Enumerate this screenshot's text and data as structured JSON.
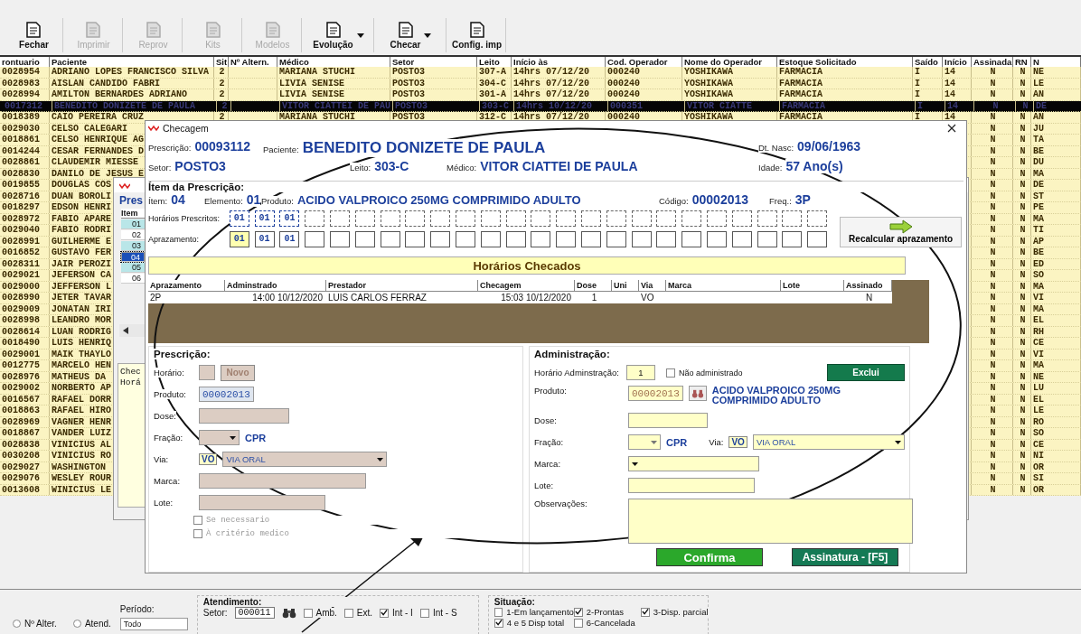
{
  "toolbar": [
    {
      "label": "Fechar",
      "disabled": false,
      "dropdown": false
    },
    {
      "label": "Imprimir",
      "disabled": true,
      "dropdown": false
    },
    {
      "label": "Reprov",
      "disabled": true,
      "dropdown": false
    },
    {
      "label": "Kits",
      "disabled": true,
      "dropdown": false
    },
    {
      "label": "Modelos",
      "disabled": true,
      "dropdown": false
    },
    {
      "label": "Evolução",
      "disabled": false,
      "dropdown": true
    },
    {
      "label": "Checar",
      "disabled": false,
      "dropdown": true
    },
    {
      "label": "Config. imp",
      "disabled": false,
      "dropdown": false
    }
  ],
  "table": {
    "columns": [
      "rontuario",
      "Paciente",
      "Sit",
      "Nº Altern.",
      "Médico",
      "Setor",
      "Leito",
      "Início às",
      "Cod. Operador",
      "Nome do Operador",
      "Estoque Solicitado",
      "Saído",
      "Início",
      "Assinada",
      "RN",
      "N"
    ],
    "rows": [
      {
        "prontuario": "0028954",
        "paciente": "ADRIANO LOPES FRANCISCO SILVA",
        "sit": "2",
        "medico": "MARIANA STUCHI",
        "setor": "POSTO3",
        "leito": "307-A",
        "inicio_as": "14hrs 07/12/20",
        "cod_operador": "000240",
        "nome_operador": "YOSHIKAWA",
        "estoque": "FARMACIA",
        "saido": "I",
        "inicio": "14",
        "assinada": "N",
        "rn": "N",
        "col_16": "NE",
        "selected": false
      },
      {
        "prontuario": "0028983",
        "paciente": "AISLAN CANDIDO FABRI",
        "sit": "2",
        "medico": "LIVIA SENISE",
        "setor": "POSTO3",
        "leito": "304-C",
        "inicio_as": "14hrs 07/12/20",
        "cod_operador": "000240",
        "nome_operador": "YOSHIKAWA",
        "estoque": "FARMACIA",
        "saido": "I",
        "inicio": "14",
        "assinada": "N",
        "rn": "N",
        "col_16": "LE",
        "selected": false
      },
      {
        "prontuario": "0028994",
        "paciente": "AMILTON BERNARDES ADRIANO",
        "sit": "2",
        "medico": "LIVIA SENISE",
        "setor": "POSTO3",
        "leito": "301-A",
        "inicio_as": "14hrs 07/12/20",
        "cod_operador": "000240",
        "nome_operador": "YOSHIKAWA",
        "estoque": "FARMACIA",
        "saido": "I",
        "inicio": "14",
        "assinada": "N",
        "rn": "N",
        "col_16": "AN",
        "selected": false
      },
      {
        "prontuario": "0017312",
        "paciente": "BENEDITO DONIZETE DE PAULA",
        "sit": "2",
        "medico": "VITOR CIATTEI DE PAU",
        "setor": "POSTO3",
        "leito": "303-C",
        "inicio_as": "14hrs 10/12/20",
        "cod_operador": "000351",
        "nome_operador": "VITOR CIATTE",
        "estoque": "FARMACIA",
        "saido": "I",
        "inicio": "14",
        "assinada": "N",
        "rn": "N",
        "col_16": "DE",
        "selected": true
      },
      {
        "prontuario": "0018389",
        "paciente": "CAIO PEREIRA CRUZ",
        "sit": "2",
        "medico": "MARIANA STUCHI",
        "setor": "POSTO3",
        "leito": "312-C",
        "inicio_as": "14hrs 07/12/20",
        "cod_operador": "000240",
        "nome_operador": "YOSHIKAWA",
        "estoque": "FARMACIA",
        "saido": "I",
        "inicio": "14",
        "assinada": "N",
        "rn": "N",
        "col_16": "AN",
        "selected": false
      },
      {
        "prontuario": "0029030",
        "paciente": "CELSO CALEGARI",
        "assinada": "N",
        "rn": "N",
        "col_16": "JU",
        "selected": false
      },
      {
        "prontuario": "0018861",
        "paciente": "CELSO HENRIQUE AG",
        "assinada": "N",
        "rn": "N",
        "col_16": "TA",
        "selected": false
      },
      {
        "prontuario": "0014244",
        "paciente": "CESAR FERNANDES D",
        "assinada": "N",
        "rn": "N",
        "col_16": "BE",
        "selected": false
      },
      {
        "prontuario": "0028861",
        "paciente": "CLAUDEMIR MIESSE",
        "assinada": "N",
        "rn": "N",
        "col_16": "DU",
        "selected": false
      },
      {
        "prontuario": "0028830",
        "paciente": "DANILO DE JESUS E",
        "assinada": "N",
        "rn": "N",
        "col_16": "MA",
        "selected": false
      },
      {
        "prontuario": "0019855",
        "paciente": "DOUGLAS COS",
        "assinada": "N",
        "rn": "N",
        "col_16": "DE",
        "selected": false
      },
      {
        "prontuario": "0028716",
        "paciente": "DUAN BOROLI",
        "assinada": "N",
        "rn": "N",
        "col_16": "ST",
        "selected": false
      },
      {
        "prontuario": "0018297",
        "paciente": "EDSON HENRI",
        "assinada": "N",
        "rn": "N",
        "col_16": "PE",
        "selected": false
      },
      {
        "prontuario": "0028972",
        "paciente": "FABIO APARE",
        "assinada": "N",
        "rn": "N",
        "col_16": "MA",
        "selected": false
      },
      {
        "prontuario": "0029040",
        "paciente": "FABIO RODRI",
        "assinada": "N",
        "rn": "N",
        "col_16": "TI",
        "selected": false
      },
      {
        "prontuario": "0028991",
        "paciente": "GUILHERME E",
        "assinada": "N",
        "rn": "N",
        "col_16": "AP",
        "selected": false
      },
      {
        "prontuario": "0016852",
        "paciente": "GUSTAVO FER",
        "assinada": "N",
        "rn": "N",
        "col_16": "BE",
        "selected": false
      },
      {
        "prontuario": "0028311",
        "paciente": "JAIR PEROZI",
        "assinada": "N",
        "rn": "N",
        "col_16": "ED",
        "selected": false
      },
      {
        "prontuario": "0029021",
        "paciente": "JEFERSON CA",
        "assinada": "N",
        "rn": "N",
        "col_16": "SO",
        "selected": false
      },
      {
        "prontuario": "0029000",
        "paciente": "JEFFERSON L",
        "assinada": "N",
        "rn": "N",
        "col_16": "MA",
        "selected": false
      },
      {
        "prontuario": "0028990",
        "paciente": "JETER TAVAR",
        "assinada": "N",
        "rn": "N",
        "col_16": "VI",
        "selected": false
      },
      {
        "prontuario": "0029009",
        "paciente": "JONATAN IRI",
        "assinada": "N",
        "rn": "N",
        "col_16": "MA",
        "selected": false
      },
      {
        "prontuario": "0028998",
        "paciente": "LEANDRO MOR",
        "assinada": "N",
        "rn": "N",
        "col_16": "EL",
        "selected": false
      },
      {
        "prontuario": "0028614",
        "paciente": "LUAN RODRIG",
        "assinada": "N",
        "rn": "N",
        "col_16": "RH",
        "selected": false
      },
      {
        "prontuario": "0018490",
        "paciente": "LUIS HENRIQ",
        "assinada": "N",
        "rn": "N",
        "col_16": "CE",
        "selected": false
      },
      {
        "prontuario": "0029001",
        "paciente": "MAIK THAYLO",
        "assinada": "N",
        "rn": "N",
        "col_16": "VI",
        "selected": false
      },
      {
        "prontuario": "0012775",
        "paciente": "MARCELO HEN",
        "assinada": "N",
        "rn": "N",
        "col_16": "MA",
        "selected": false
      },
      {
        "prontuario": "0028976",
        "paciente": "MATHEUS DA",
        "assinada": "N",
        "rn": "N",
        "col_16": "NE",
        "selected": false
      },
      {
        "prontuario": "0029002",
        "paciente": "NORBERTO AP",
        "assinada": "N",
        "rn": "N",
        "col_16": "LU",
        "selected": false
      },
      {
        "prontuario": "0016567",
        "paciente": "RAFAEL DORR",
        "assinada": "N",
        "rn": "N",
        "col_16": "EL",
        "selected": false
      },
      {
        "prontuario": "0018863",
        "paciente": "RAFAEL HIRO",
        "assinada": "N",
        "rn": "N",
        "col_16": "LE",
        "selected": false
      },
      {
        "prontuario": "0028969",
        "paciente": "VAGNER HENR",
        "assinada": "N",
        "rn": "N",
        "col_16": "RO",
        "selected": false
      },
      {
        "prontuario": "0018867",
        "paciente": "VANDER LUIZ",
        "assinada": "N",
        "rn": "N",
        "col_16": "SO",
        "selected": false
      },
      {
        "prontuario": "0028838",
        "paciente": "VINICIUS AL",
        "assinada": "N",
        "rn": "N",
        "col_16": "CE",
        "selected": false
      },
      {
        "prontuario": "0030208",
        "paciente": "VINICIUS RO",
        "assinada": "N",
        "rn": "N",
        "col_16": "NI",
        "selected": false
      },
      {
        "prontuario": "0029027",
        "paciente": "WASHINGTON",
        "assinada": "N",
        "rn": "N",
        "col_16": "OR",
        "selected": false
      },
      {
        "prontuario": "0029076",
        "paciente": "WESLEY ROUR",
        "assinada": "N",
        "rn": "N",
        "col_16": "SI",
        "selected": false
      },
      {
        "prontuario": "0013608",
        "paciente": "WINICIUS LE",
        "assinada": "N",
        "rn": "N",
        "col_16": "OR",
        "selected": false
      }
    ]
  },
  "prescricao_window": {
    "title_fragment": "Pres",
    "item_header": "Item",
    "items": [
      {
        "label": "01",
        "selected": false,
        "color": "#b9e6e8"
      },
      {
        "label": "02",
        "selected": false,
        "color": "#ffffff"
      },
      {
        "label": "03",
        "selected": false,
        "color": "#b9e6e8"
      },
      {
        "label": "04",
        "selected": true,
        "color": "#1b4fb8"
      },
      {
        "label": "05",
        "selected": false,
        "color": "#b9e6e8"
      },
      {
        "label": "06",
        "selected": false,
        "color": "#ffffff"
      }
    ],
    "notes": [
      "Chec",
      "Horá"
    ]
  },
  "checagem": {
    "title": "Checagem",
    "header": [
      {
        "label": "Prescrição:",
        "value": "00093112"
      },
      {
        "label": "Paciente:",
        "value": "BENEDITO DONIZETE DE PAULA"
      },
      {
        "label": "Dt. Nasc:",
        "value": "09/06/1963"
      },
      {
        "label": "Setor:",
        "value": "POSTO3"
      },
      {
        "label": "Leito:",
        "value": "303-C"
      },
      {
        "label": "Médico:",
        "value": "VITOR CIATTEI DE PAULA"
      },
      {
        "label": "Idade:",
        "value": "57 Ano(s)"
      }
    ],
    "item_group": {
      "legend": "Ítem da Prescrição:",
      "fields": [
        {
          "label": "Ítem:",
          "value": "04"
        },
        {
          "label": "Elemento:",
          "value": "01"
        },
        {
          "label": "Produto:",
          "value": "ACIDO VALPROICO 250MG COMPRIMIDO ADULTO"
        },
        {
          "label": "Código:",
          "value": "00002013"
        },
        {
          "label": "Freq.:",
          "value": "3P"
        }
      ],
      "prescritos_label": "Horários Prescritos:",
      "prescritos": [
        "01",
        "01",
        "01"
      ],
      "aprazamento_label": "Aprazamento:",
      "aprazamento": [
        {
          "value": "01",
          "selected": true
        },
        {
          "value": "01",
          "selected": false
        },
        {
          "value": "01",
          "selected": false
        }
      ],
      "recalcular": "Recalcular aprazamento"
    },
    "banner": "Horários Checados",
    "checked_table": {
      "columns": [
        "Aprazamento",
        "Adminstrado",
        "Prestador",
        "Checagem",
        "Dose",
        "Uni",
        "Via",
        "Marca",
        "Lote",
        "Assinado"
      ],
      "rows": [
        [
          "2P",
          "14:00  10/12/2020",
          "LUIS CARLOS FERRAZ",
          "15:03  10/12/2020",
          "1",
          null,
          "VO",
          null,
          null,
          "N"
        ]
      ]
    },
    "prescricao": {
      "legend": "Prescrição:",
      "horario_label": "Horário:",
      "novo": {
        "label": "Novo",
        "disabled": true
      },
      "produto_label": "Produto:",
      "produto": "00002013",
      "dose_label": "Dose:",
      "fracao_label": "Fração:",
      "fracao_unit": "CPR",
      "via_label": "Via:",
      "via_code": "VO",
      "via": "VIA ORAL",
      "marca_label": "Marca:",
      "lote_label": "Lote:",
      "checks": [
        {
          "label": "Se necessario",
          "checked": false,
          "disabled": true
        },
        {
          "label": "À critério medico",
          "checked": false,
          "disabled": true
        }
      ]
    },
    "administracao": {
      "legend": "Administração:",
      "horario_label": "Horário Adminstração:",
      "horario": "1",
      "nao_admin": {
        "label": "Não administrado",
        "checked": false
      },
      "exclui": "Exclui",
      "produto_label": "Produto:",
      "produto": "00002013",
      "produto_nome": "ACIDO VALPROICO 250MG COMPRIMIDO ADULTO",
      "dose_label": "Dose:",
      "fracao_label": "Fração:",
      "fracao_unit": "CPR",
      "via_label": "Via:",
      "via_code": "VO",
      "via": "VIA ORAL",
      "marca_label": "Marca:",
      "lote_label": "Lote:",
      "obs_label": "Observações:"
    },
    "buttons": [
      {
        "label": "Confirma",
        "kind": "confirm"
      },
      {
        "label": "Assinatura - [F5]",
        "kind": "sign"
      }
    ]
  },
  "filters": {
    "radios": [
      {
        "label": "Nº Alter.",
        "selected": false
      },
      {
        "label": "Atend.",
        "selected": false
      }
    ],
    "periodo_label": "Período:",
    "periodo": "Todo",
    "atendimento": {
      "legend": "Atendimento:",
      "setor_label": "Setor:",
      "setor": "000011",
      "checks": [
        {
          "label": "Amb.",
          "checked": false
        },
        {
          "label": "Ext.",
          "checked": false
        },
        {
          "label": "Int - I",
          "checked": true
        },
        {
          "label": "Int - S",
          "checked": false
        }
      ]
    },
    "situacao": {
      "legend": "Situação:",
      "checks": [
        {
          "label": "1-Em lançamento",
          "checked": false
        },
        {
          "label": "2-Prontas",
          "checked": true
        },
        {
          "label": "3-Disp. parcial",
          "checked": true
        },
        {
          "label": "4 e 5 Disp total",
          "checked": true
        },
        {
          "label": "6-Cancelada",
          "checked": false
        }
      ]
    }
  }
}
